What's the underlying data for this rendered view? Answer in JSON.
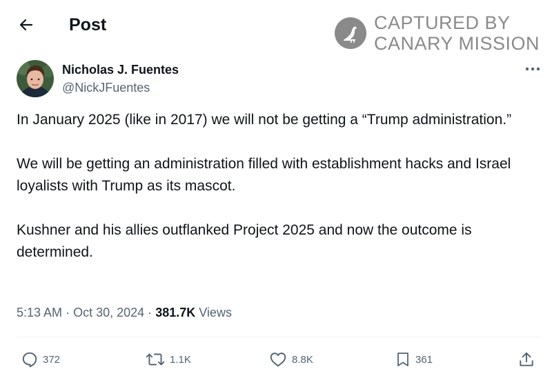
{
  "header": {
    "title": "Post",
    "back_icon": "arrow-left-icon"
  },
  "watermark": {
    "line1": "CAPTURED BY",
    "line2": "CANARY MISSION",
    "color": "#8a8a8a"
  },
  "author": {
    "name": "Nicholas J. Fuentes",
    "handle": "@NickJFuentes"
  },
  "post": {
    "paragraphs": [
      "In January 2025 (like in 2017) we will not be getting a “Trump administration.”",
      "We will be getting an administration filled with establishment hacks and Israel loyalists with Trump as its mascot.",
      "Kushner and his allies outflanked Project 2025 and now the outcome is determined."
    ]
  },
  "meta": {
    "time": "5:13 AM",
    "separator": "·",
    "date": "Oct 30, 2024",
    "views_count": "381.7K",
    "views_label": "Views"
  },
  "actions": {
    "reply": {
      "icon": "reply-icon",
      "count": "372"
    },
    "repost": {
      "icon": "repost-icon",
      "count": "1.1K"
    },
    "like": {
      "icon": "heart-icon",
      "count": "8.8K"
    },
    "bookmark": {
      "icon": "bookmark-icon",
      "count": "361"
    },
    "share": {
      "icon": "share-icon"
    }
  },
  "colors": {
    "text": "#0f1419",
    "secondary": "#536471",
    "divider": "#eff3f4"
  }
}
